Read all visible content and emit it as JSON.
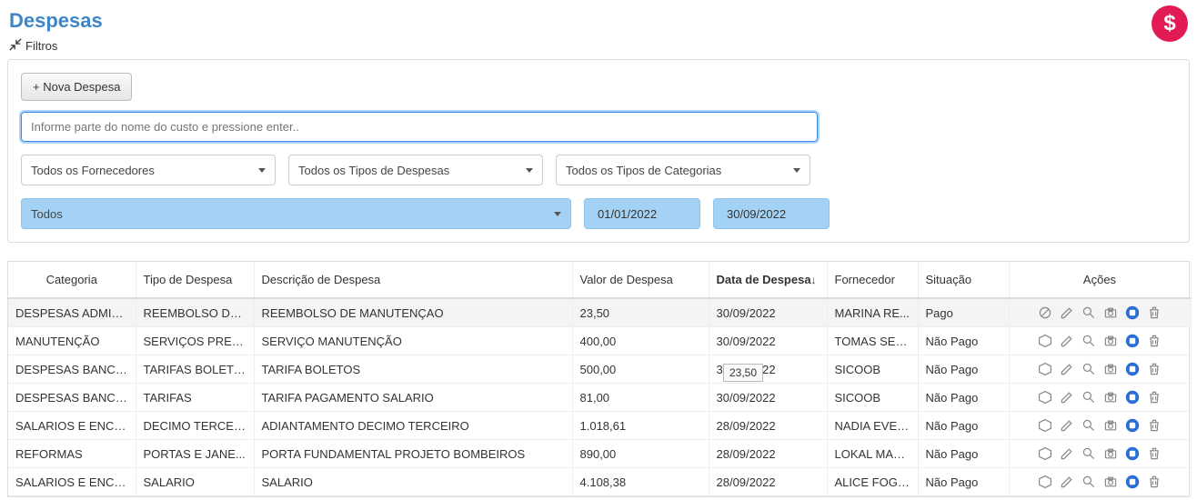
{
  "title": "Despesas",
  "filters_label": "Filtros",
  "new_button": "+ Nova Despesa",
  "search_placeholder": "Informe parte do nome do custo e pressione enter..",
  "select_fornecedores": "Todos os Fornecedores",
  "select_tipos_despesas": "Todos os Tipos de Despesas",
  "select_tipos_categorias": "Todos os Tipos de Categorias",
  "select_situacao": "Todos",
  "date_from": "01/01/2022",
  "date_to": "30/09/2022",
  "tooltip_value": "23,50",
  "columns": {
    "categoria": "Categoria",
    "tipo": "Tipo de Despesa",
    "descricao": "Descrição de Despesa",
    "valor": "Valor de Despesa",
    "data": "Data de Despesa",
    "fornecedor": "Fornecedor",
    "situacao": "Situação",
    "acoes": "Ações"
  },
  "sort_indicator": "↓",
  "rows": [
    {
      "categoria": "DESPESAS ADMINI...",
      "tipo": "REEMBOLSO DE...",
      "descricao": "REEMBOLSO DE MANUTENÇAO",
      "valor": "23,50",
      "data": "30/09/2022",
      "fornecedor": "MARINA RE...",
      "situacao": "Pago",
      "blocked": true
    },
    {
      "categoria": "MANUTENÇÃO",
      "tipo": "SERVIÇOS PRES...",
      "descricao": "SERVIÇO MANUTENÇÃO",
      "valor": "400,00",
      "data": "30/09/2022",
      "fornecedor": "TOMAS SER...",
      "situacao": "Não Pago",
      "blocked": false
    },
    {
      "categoria": "DESPESAS BANCÁ...",
      "tipo": "TARIFAS BOLETOS",
      "descricao": "TARIFA BOLETOS",
      "valor": "500,00",
      "data": "30/09/2022",
      "fornecedor": "SICOOB",
      "situacao": "Não Pago",
      "blocked": false
    },
    {
      "categoria": "DESPESAS BANCÁ...",
      "tipo": "TARIFAS",
      "descricao": "TARIFA PAGAMENTO SALARIO",
      "valor": "81,00",
      "data": "30/09/2022",
      "fornecedor": "SICOOB",
      "situacao": "Não Pago",
      "blocked": false
    },
    {
      "categoria": "SALARIOS E ENCA...",
      "tipo": "DECIMO TERCEI...",
      "descricao": "ADIANTAMENTO DECIMO TERCEIRO",
      "valor": "1.018,61",
      "data": "28/09/2022",
      "fornecedor": "NADIA EVEL...",
      "situacao": "Não Pago",
      "blocked": false
    },
    {
      "categoria": "REFORMAS",
      "tipo": "PORTAS E JANE...",
      "descricao": "PORTA FUNDAMENTAL PROJETO BOMBEIROS",
      "valor": "890,00",
      "data": "28/09/2022",
      "fornecedor": "LOKAL MAD...",
      "situacao": "Não Pago",
      "blocked": false
    },
    {
      "categoria": "SALARIOS E ENCA...",
      "tipo": "SALARIO",
      "descricao": "SALARIO",
      "valor": "4.108,38",
      "data": "28/09/2022",
      "fornecedor": "ALICE FOGA...",
      "situacao": "Não Pago",
      "blocked": false
    }
  ]
}
